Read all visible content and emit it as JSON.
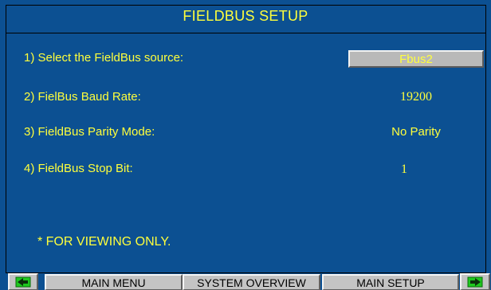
{
  "screen": {
    "title": "FIELDBUS SETUP",
    "rows": [
      {
        "label": "1) Select the FieldBus source:",
        "value": "Fbus2"
      },
      {
        "label": "2) FielBus Baud Rate:",
        "value": "19200"
      },
      {
        "label": "3) FieldBus Parity Mode:",
        "value": "No Parity"
      },
      {
        "label": "4) FieldBus Stop Bit:",
        "value": "1"
      }
    ],
    "note": "* FOR VIEWING ONLY."
  },
  "nav": {
    "prev_icon": "left-arrow-icon",
    "next_icon": "right-arrow-icon",
    "buttons": [
      "MAIN MENU",
      "SYSTEM OVERVIEW",
      "MAIN SETUP"
    ]
  },
  "colors": {
    "background": "#0c5092",
    "text": "#ffff3c",
    "button": "#c4c4c4",
    "arrow": "#1ec81e"
  }
}
